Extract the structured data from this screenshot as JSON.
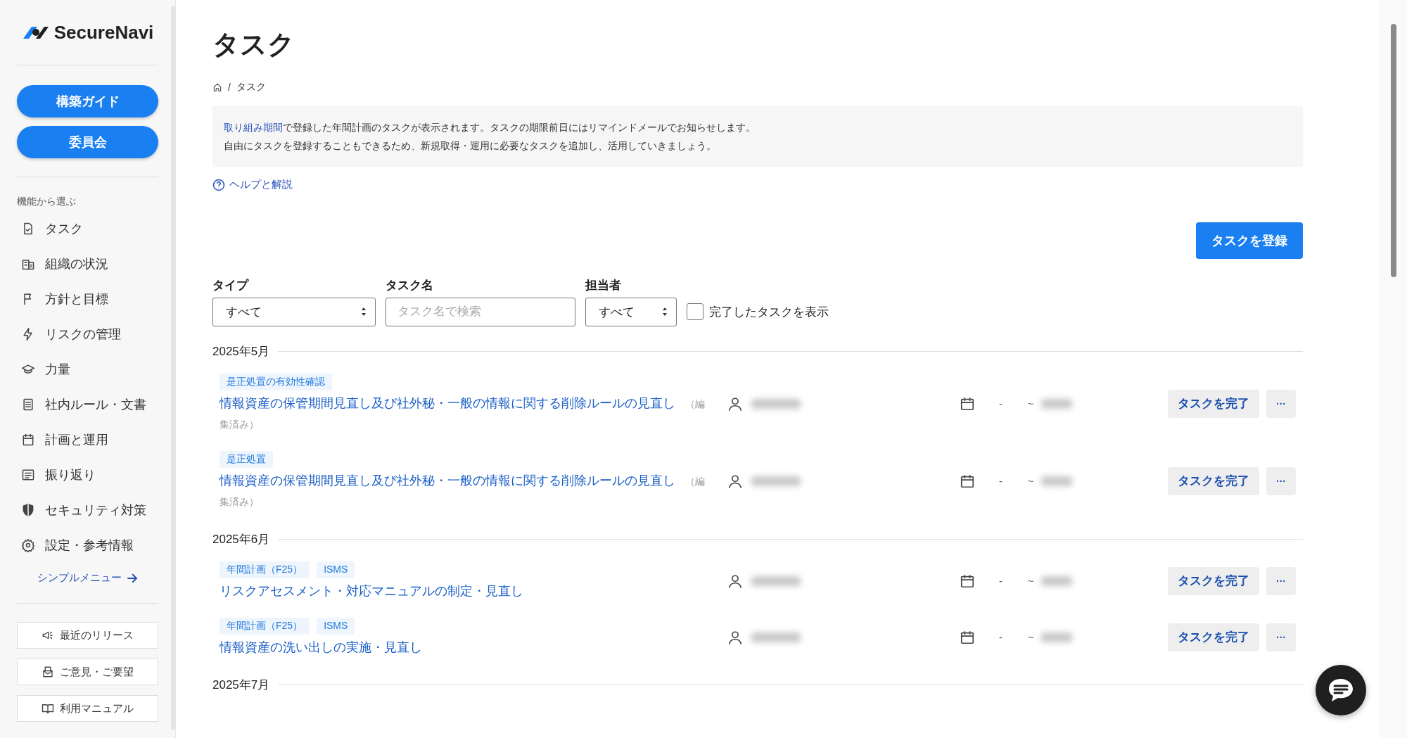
{
  "sidebar": {
    "logo": "SecureNavi",
    "primary_buttons": [
      "構築ガイド",
      "委員会"
    ],
    "section_label": "機能から選ぶ",
    "items": [
      {
        "label": "タスク",
        "selected": false
      },
      {
        "label": "組織の状況",
        "selected": false
      },
      {
        "label": "方針と目標",
        "selected": false
      },
      {
        "label": "リスクの管理",
        "selected": false
      },
      {
        "label": "力量",
        "selected": false
      },
      {
        "label": "社内ルール・文書",
        "selected": false
      },
      {
        "label": "計画と運用",
        "selected": false
      },
      {
        "label": "振り返り",
        "selected": false
      },
      {
        "label": "セキュリティ対策",
        "selected": false
      },
      {
        "label": "設定・参考情報",
        "selected": false
      }
    ],
    "simple_menu_link": "シンプルメニュー",
    "bottom_buttons": [
      "最近のリリース",
      "ご意見・ご要望",
      "利用マニュアル"
    ]
  },
  "page": {
    "title": "タスク",
    "breadcrumb": [
      "タスク"
    ],
    "breadcrumb_separator": "/",
    "info": {
      "link": "取り組み期間",
      "line1_rest": "で登録した年間計画のタスクが表示されます。タスクの期限前日にはリマインドメールでお知らせします。",
      "line2": "自由にタスクを登録することもできるため、新規取得・運用に必要なタスクを追加し、活用していきましょう。"
    },
    "help_link": "ヘルプと解説",
    "register_button": "タスクを登録",
    "filters": {
      "type": {
        "label": "タイプ",
        "value": "すべて"
      },
      "name": {
        "label": "タスク名",
        "placeholder": "タスク名で検索"
      },
      "assignee": {
        "label": "担当者",
        "value": "すべて"
      },
      "show_completed": {
        "label": "完了したタスクを表示",
        "checked": false
      }
    },
    "groups": [
      {
        "month": "2025年5月",
        "tasks": [
          {
            "tags": [
              "是正処置の有効性確認"
            ],
            "title": "情報資産の保管期間見直し及び社外秘・一般の情報に関する削除ルールの見直し",
            "note": "（編集済み）",
            "start": "-",
            "separator": "~",
            "complete_button": "タスクを完了",
            "more_button": "···"
          },
          {
            "tags": [
              "是正処置"
            ],
            "title": "情報資産の保管期間見直し及び社外秘・一般の情報に関する削除ルールの見直し",
            "note": "（編集済み）",
            "start": "-",
            "separator": "~",
            "complete_button": "タスクを完了",
            "more_button": "···"
          }
        ]
      },
      {
        "month": "2025年6月",
        "tasks": [
          {
            "tags": [
              "年間計画（F25）",
              "ISMS"
            ],
            "title": "リスクアセスメント・対応マニュアルの制定・見直し",
            "start": "-",
            "separator": "~",
            "complete_button": "タスクを完了",
            "more_button": "···"
          },
          {
            "tags": [
              "年間計画（F25）",
              "ISMS"
            ],
            "title": "情報資産の洗い出しの実施・見直し",
            "start": "-",
            "separator": "~",
            "complete_button": "タスクを完了",
            "more_button": "···"
          }
        ]
      },
      {
        "month": "2025年7月"
      }
    ]
  }
}
